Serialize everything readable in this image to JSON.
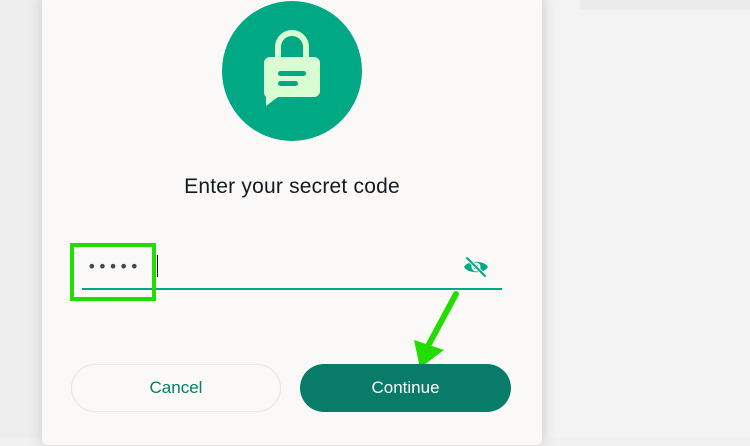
{
  "dialog": {
    "title": "Enter your secret code",
    "input": {
      "value": "•••••"
    },
    "buttons": {
      "cancel_label": "Cancel",
      "continue_label": "Continue"
    }
  },
  "icons": {
    "lock": "lock-with-message-icon",
    "visibility": "eye-off-icon"
  },
  "colors": {
    "accent": "#00a884",
    "primary_button": "#087c68",
    "highlight": "#22dd00"
  }
}
